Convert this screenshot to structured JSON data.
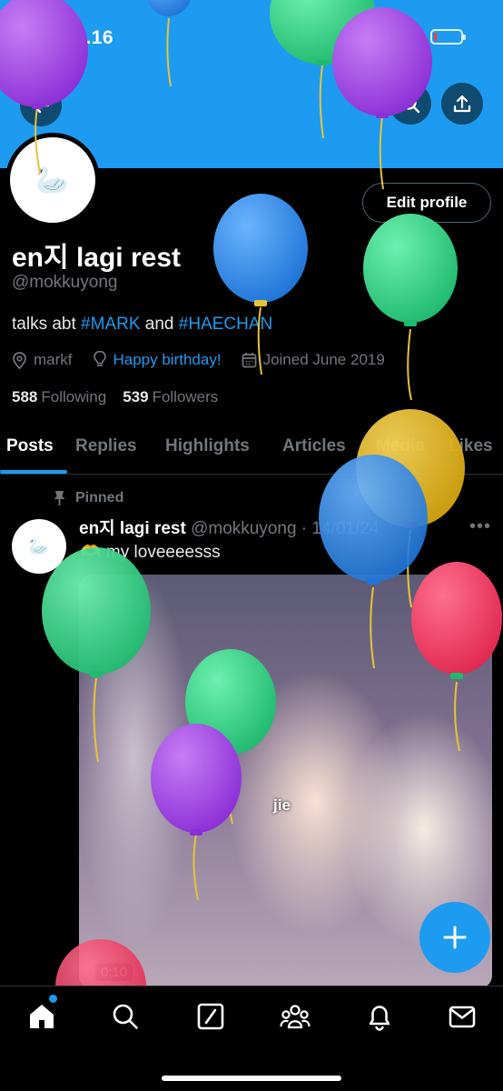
{
  "status_bar": {
    "time": "00.16",
    "network": "4G",
    "battery_level": 0.12,
    "battery_color": "#ff3b30"
  },
  "header": {
    "back_icon": "back-arrow-icon",
    "search_icon": "search-icon",
    "share_icon": "share-icon"
  },
  "profile": {
    "avatar_emoji": "🦢",
    "edit_label": "Edit profile",
    "name": "en지 lagi rest",
    "handle": "@mokkuyong",
    "bio_prefix": "talks abt ",
    "bio_tag1": "#MARK",
    "bio_mid": " and ",
    "bio_tag2": "#HAECHAN",
    "location": "markf",
    "website": "Happy birthday!",
    "joined": "Joined June 2019",
    "following_count": "588",
    "following_label": "Following",
    "followers_count": "539",
    "followers_label": "Followers"
  },
  "tabs": [
    "Posts",
    "Replies",
    "Highlights",
    "Articles",
    "Media",
    "Likes"
  ],
  "active_tab": "Posts",
  "post": {
    "pinned_label": "Pinned",
    "author_name": "en지 lagi rest",
    "author_handle": "@mokkuyong · 14/01/24",
    "avatar_emoji": "🦢",
    "text": "🫶 my loveeeesss",
    "media_caption": "jie",
    "media_duration": "0:10"
  },
  "colors": {
    "accent": "#1d9bf0",
    "background": "#000000",
    "muted": "#71767b"
  },
  "bottom_nav": [
    "home-icon",
    "search-icon",
    "grok-icon",
    "communities-icon",
    "notifications-icon",
    "messages-icon"
  ]
}
